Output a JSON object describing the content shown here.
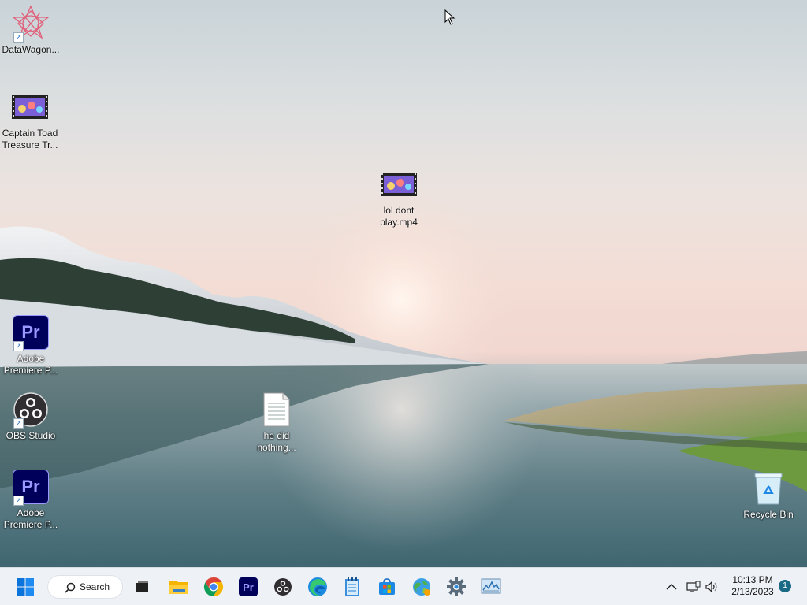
{
  "desktop": {
    "icons": [
      {
        "name": "datawagon",
        "label": "DataWagon..."
      },
      {
        "name": "captain-toad",
        "label": "Captain Toad Treasure Tr..."
      },
      {
        "name": "lol-dont-play",
        "label": "lol dont play.mp4"
      },
      {
        "name": "premiere-1",
        "label": "Adobe Premiere P...",
        "tile_text": "Pr"
      },
      {
        "name": "obs",
        "label": "OBS Studio"
      },
      {
        "name": "he-did-nothing",
        "label": "he did nothing..."
      },
      {
        "name": "premiere-2",
        "label": "Adobe Premiere P...",
        "tile_text": "Pr"
      },
      {
        "name": "recycle-bin",
        "label": "Recycle Bin"
      }
    ]
  },
  "taskbar": {
    "search_label": "Search",
    "pinned": [
      {
        "name": "start-button",
        "icon": "windows-logo-icon"
      },
      {
        "name": "task-view-button",
        "icon": "task-view-icon"
      },
      {
        "name": "file-explorer-button",
        "icon": "folder-icon"
      },
      {
        "name": "chrome-button",
        "icon": "chrome-icon"
      },
      {
        "name": "premiere-button",
        "icon": "premiere-icon",
        "text": "Pr"
      },
      {
        "name": "obs-button",
        "icon": "obs-icon"
      },
      {
        "name": "edge-button",
        "icon": "edge-icon"
      },
      {
        "name": "notepad-button",
        "icon": "notepad-icon"
      },
      {
        "name": "store-button",
        "icon": "store-icon"
      },
      {
        "name": "maps-button",
        "icon": "globe-icon"
      },
      {
        "name": "settings-button",
        "icon": "gear-icon"
      },
      {
        "name": "monitor-button",
        "icon": "resource-monitor-icon"
      }
    ],
    "tray": {
      "time": "10:13 PM",
      "date": "2/13/2023",
      "notification_count": "1"
    }
  },
  "colors": {
    "taskbar_bg": "#eef1f6",
    "premiere_bg": "#00005b",
    "premiere_fg": "#9999ff",
    "accent": "#0067c0"
  }
}
